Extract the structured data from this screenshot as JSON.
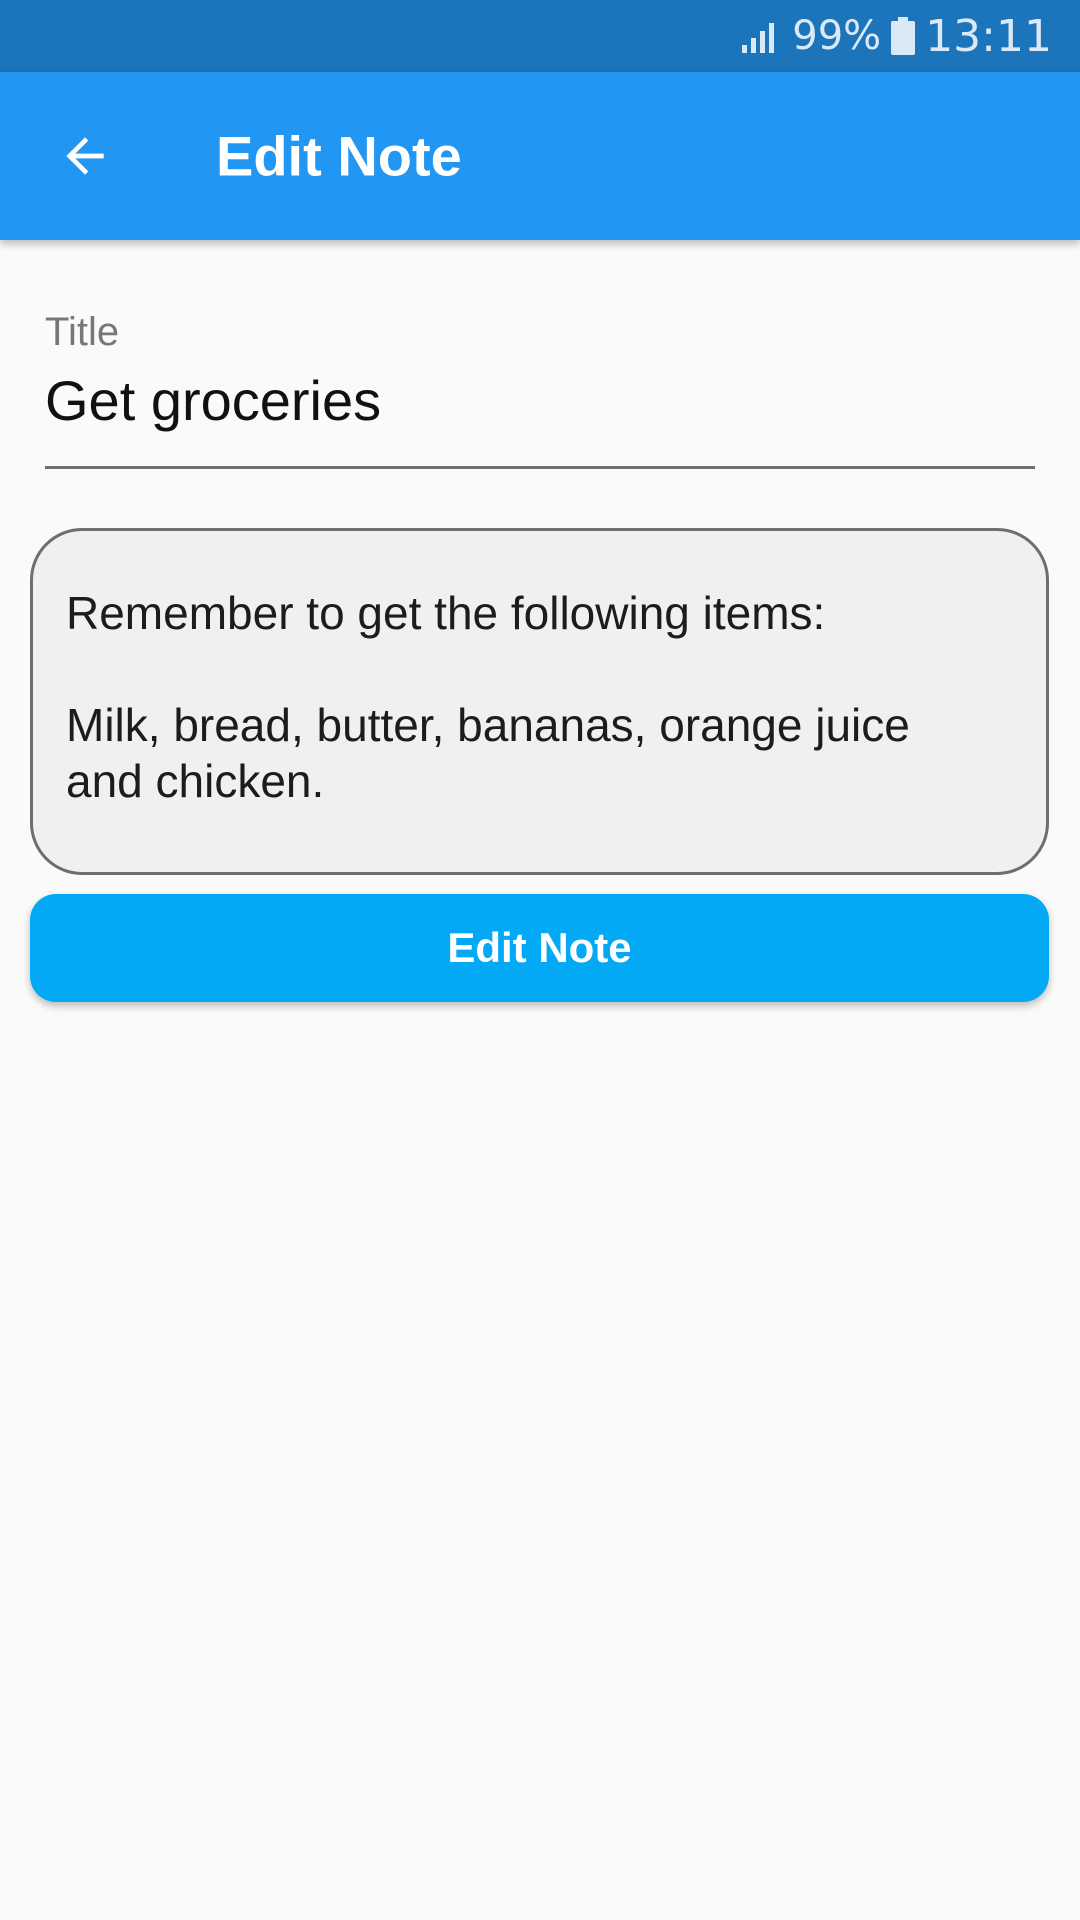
{
  "status_bar": {
    "battery_percent": "99%",
    "time": "13:11",
    "signal_icon": "signal-icon",
    "battery_icon": "battery-icon"
  },
  "app_bar": {
    "back_icon": "arrow-back-icon",
    "title": "Edit Note",
    "color": "#2196f3"
  },
  "form": {
    "title_label": "Title",
    "title_value": "Get groceries",
    "body_lines": [
      "Remember to get the following items:",
      "",
      "Milk, bread, butter, bananas, orange juice",
      "and chicken."
    ],
    "submit_label": "Edit Note",
    "submit_color": "#03a9f4"
  }
}
